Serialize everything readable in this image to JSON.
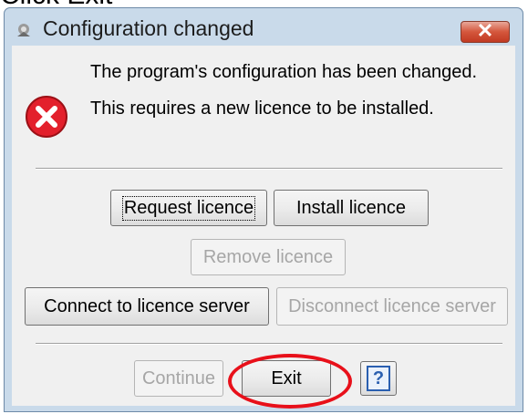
{
  "caption": "Click Exit",
  "window": {
    "title": "Configuration changed",
    "close_label": "✕"
  },
  "message": {
    "line1": "The program's configuration has been changed.",
    "line2": "This requires a new licence to be installed."
  },
  "buttons": {
    "request": "Request licence",
    "install": "Install licence",
    "remove": "Remove licence",
    "connect": "Connect to licence server",
    "disconnect": "Disconnect licence server",
    "continue": "Continue",
    "exit": "Exit",
    "help": "?"
  },
  "icons": {
    "app": "program-icon",
    "error": "error-icon",
    "help": "help-icon"
  },
  "colors": {
    "titlebar": "#c9daea",
    "close": "#d4563c",
    "error": "#e3202c",
    "highlight": "#e8101a"
  }
}
